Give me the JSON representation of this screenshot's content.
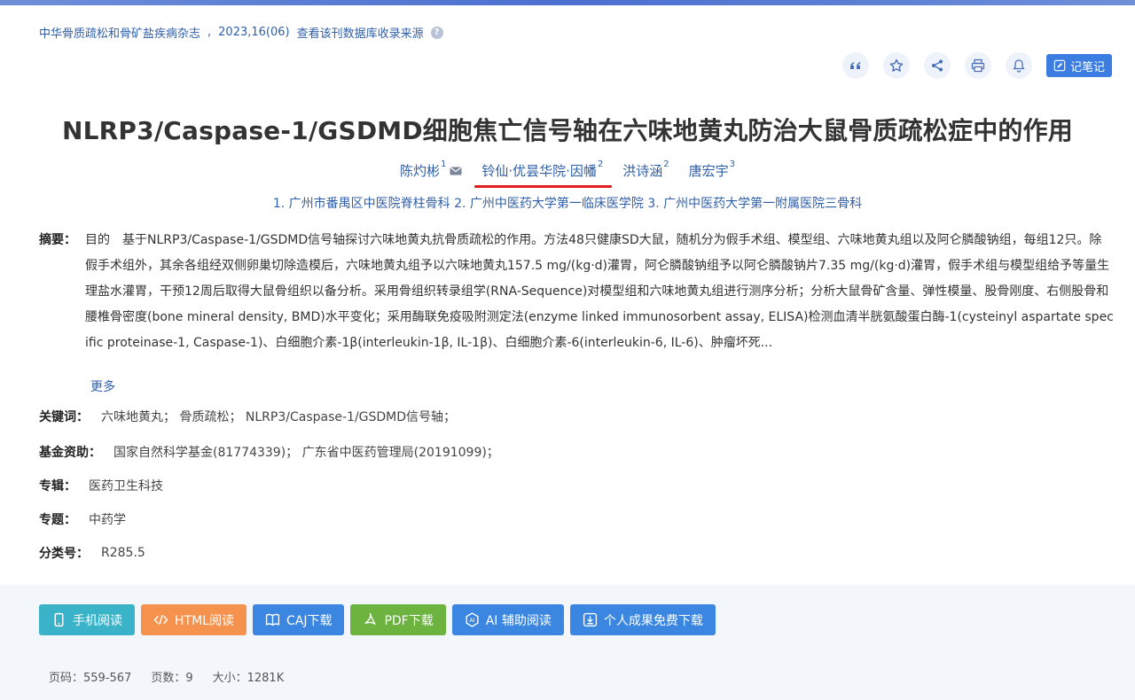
{
  "source": {
    "journal": "中华骨质疏松和骨矿盐疾病杂志",
    "issue": "2023,16(06)",
    "db_link": "查看该刊数据库收录来源",
    "help": "?"
  },
  "toolbar": {
    "note_label": "记笔记"
  },
  "article": {
    "title": "NLRP3/Caspase-1/GSDMD细胞焦亡信号轴在六味地黄丸防治大鼠骨质疏松症中的作用",
    "authors": [
      {
        "name": "陈灼彬",
        "sup": "1"
      },
      {
        "name": "铃仙·优昙华院·因幡",
        "sup": "2"
      },
      {
        "name": "洪诗涵",
        "sup": "2"
      },
      {
        "name": "唐宏宇",
        "sup": "3"
      }
    ],
    "affiliations": "1. 广州市番禺区中医院脊柱骨科   2. 广州中医药大学第一临床医学院   3. 广州中医药大学第一附属医院三骨科",
    "abstract_label": "摘要：",
    "abstract": "目的　基于NLRP3/Caspase-1/GSDMD信号轴探讨六味地黄丸抗骨质疏松的作用。方法48只健康SD大鼠，随机分为假手术组、模型组、六味地黄丸组以及阿仑膦酸钠组，每组12只。除假手术组外，其余各组经双侧卵巢切除造模后，六味地黄丸组予以六味地黄丸157.5 mg/(kg·d)灌胃，阿仑膦酸钠组予以阿仑膦酸钠片7.35 mg/(kg·d)灌胃，假手术组与模型组给予等量生理盐水灌胃，干预12周后取得大鼠骨组织以备分析。采用骨组织转录组学(RNA-Sequence)对模型组和六味地黄丸组进行测序分析；分析大鼠骨矿含量、弹性模量、股骨刚度、右侧股骨和腰椎骨密度(bone mineral density, BMD)水平变化；采用酶联免疫吸附测定法(enzyme linked immunosorbent assay, ELISA)检测血清半胱氨酸蛋白酶-1(cysteinyl aspartate specific proteinase-1, Caspase-1)、白细胞介素-1β(interleukin-1β, IL-1β)、白细胞介素-6(interleukin-6, IL-6)、肿瘤坏死...",
    "more": "更多",
    "keywords_label": "关键词：",
    "keywords": "六味地黄丸；  骨质疏松；  NLRP3/Caspase-1/GSDMD信号轴；",
    "funding_label": "基金资助：",
    "funding": "国家自然科学基金(81774339)；  广东省中医药管理局(20191099)；",
    "series_label": "专辑：",
    "series": "医药卫生科技",
    "topic_label": "专题：",
    "topic": "中药学",
    "class_label": "分类号：",
    "class": "R285.5"
  },
  "downloads": {
    "mobile": "手机阅读",
    "html": "HTML阅读",
    "caj": "CAJ下载",
    "pdf": "PDF下载",
    "ai": "AI 辅助阅读",
    "personal": "个人成果免费下载"
  },
  "stats": {
    "pages": "页码：559-567",
    "page_count": "页数：9",
    "size": "大小：1281K"
  },
  "colors": {
    "link": "#2f5fa8",
    "underline": "#e02020",
    "primary": "#3b7de0"
  }
}
